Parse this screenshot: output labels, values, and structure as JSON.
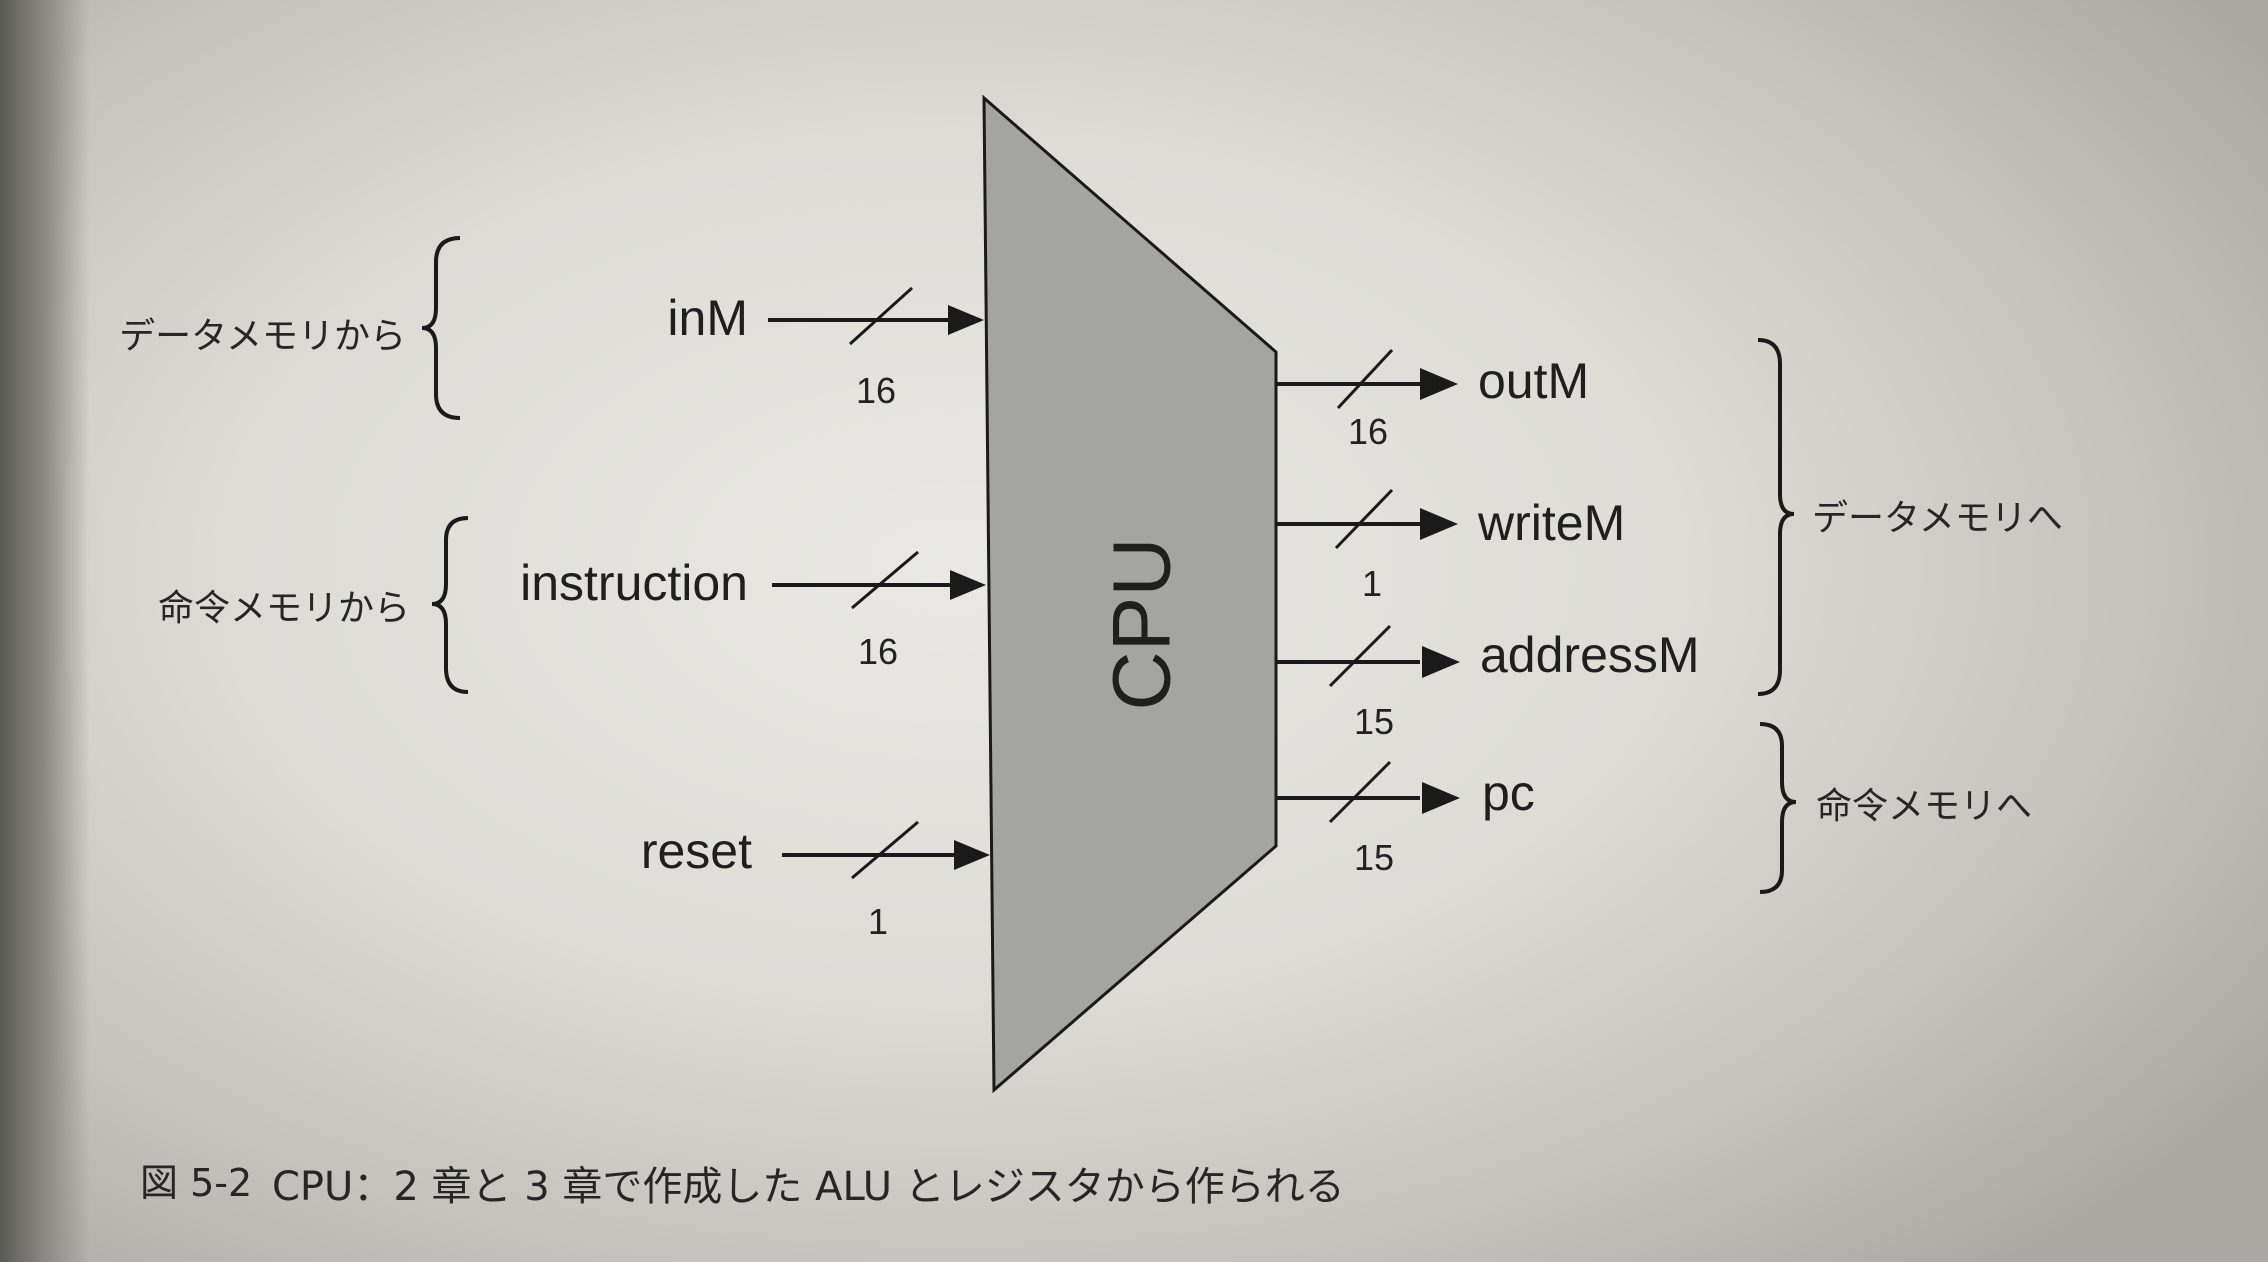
{
  "block_label": "CPU",
  "inputs": [
    {
      "name": "inM",
      "width": "16"
    },
    {
      "name": "instruction",
      "width": "16"
    },
    {
      "name": "reset",
      "width": "1"
    }
  ],
  "outputs": [
    {
      "name": "outM",
      "width": "16"
    },
    {
      "name": "writeM",
      "width": "1"
    },
    {
      "name": "addressM",
      "width": "15"
    },
    {
      "name": "pc",
      "width": "15"
    }
  ],
  "brace_labels": {
    "from_data_memory": "データメモリから",
    "from_instruction_memory": "命令メモリから",
    "to_data_memory": "データメモリへ",
    "to_instruction_memory": "命令メモリへ"
  },
  "caption": {
    "figure_number": "図 5-2",
    "text": "CPU：2 章と 3 章で作成した ALU とレジスタから作られる"
  },
  "colors": {
    "cpu_fill": "#a4a4a2",
    "line": "#1a1a1a"
  }
}
